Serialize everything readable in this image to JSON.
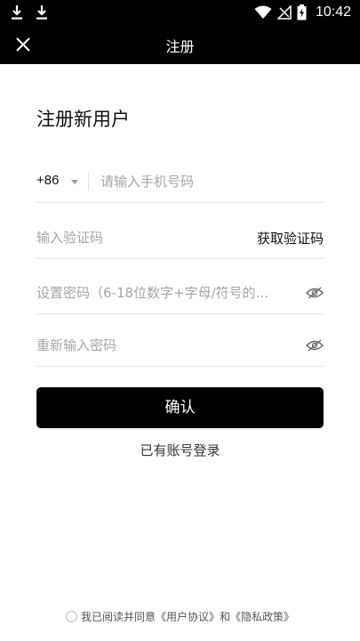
{
  "status_bar": {
    "time": "10:42",
    "icons": [
      "download-icon",
      "download-icon",
      "wifi-icon",
      "signal-icon",
      "battery-charging-icon"
    ]
  },
  "header": {
    "title": "注册",
    "close_icon": "close-icon"
  },
  "form": {
    "heading": "注册新用户",
    "country_code": "+86",
    "phone_placeholder": "请输入手机号码",
    "code_placeholder": "输入验证码",
    "get_code_label": "获取验证码",
    "password_placeholder": "设置密码（6-18位数字+字母/符号的...",
    "confirm_password_placeholder": "重新输入密码",
    "confirm_label": "确认",
    "login_link": "已有账号登录"
  },
  "agreement": {
    "prefix": "我已阅读并同意",
    "user_agreement": "《用户协议》",
    "conjunction": "和",
    "privacy_policy": "《隐私政策》"
  }
}
